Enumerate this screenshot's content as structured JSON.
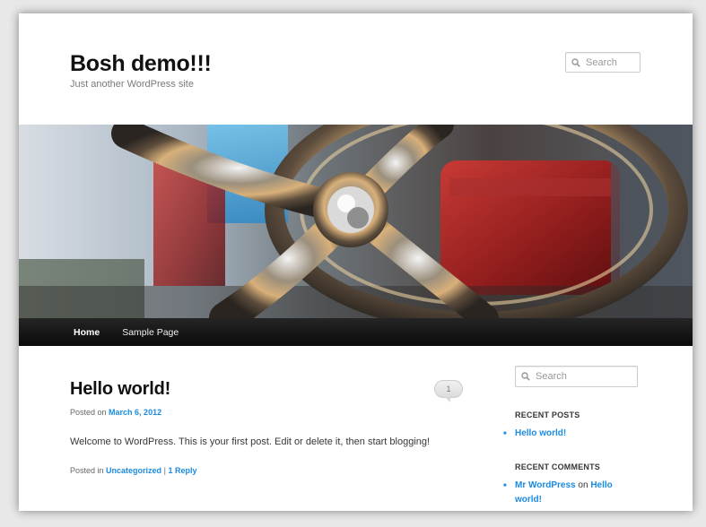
{
  "header": {
    "site_title": "Bosh demo!!!",
    "tagline": "Just another WordPress site",
    "search_placeholder": "Search"
  },
  "nav": {
    "items": [
      {
        "label": "Home",
        "current": true
      },
      {
        "label": "Sample Page",
        "current": false
      }
    ]
  },
  "post": {
    "title": "Hello world!",
    "comment_count": "1",
    "meta_prefix": "Posted on",
    "date": "March 6, 2012",
    "content": "Welcome to WordPress. This is your first post. Edit or delete it, then start blogging!",
    "footer_prefix": "Posted in",
    "category": "Uncategorized",
    "separator": "|",
    "reply_link": "1 Reply"
  },
  "sidebar": {
    "search_placeholder": "Search",
    "recent_posts_title": "RECENT POSTS",
    "recent_posts": [
      "Hello world!"
    ],
    "recent_comments_title": "RECENT COMMENTS",
    "recent_comment": {
      "author": "Mr WordPress",
      "on_word": "on",
      "post": "Hello world!"
    }
  },
  "colors": {
    "link": "#1b8be0",
    "nav_bg": "#111111",
    "title": "#111111"
  },
  "icons": {
    "search": "search-icon"
  }
}
